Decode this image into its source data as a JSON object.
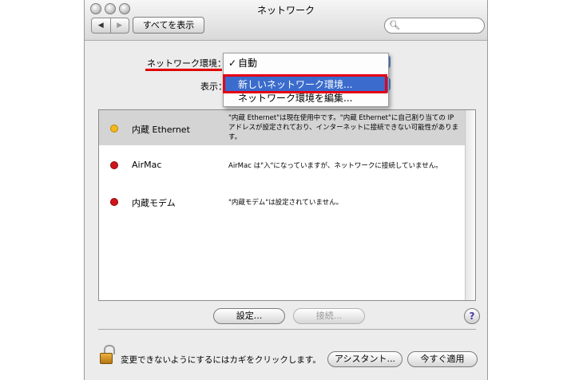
{
  "window": {
    "title": "ネットワーク"
  },
  "toolbar": {
    "back": "◀",
    "forward": "▶",
    "show_all": "すべてを表示",
    "search_placeholder": ""
  },
  "location": {
    "label": "ネットワーク環境："
  },
  "show": {
    "label": "表示："
  },
  "location_menu": {
    "items": [
      {
        "label": "自動",
        "checked": true
      },
      {
        "label": "新しいネットワーク環境...",
        "selected": true
      },
      {
        "label": "ネットワーク環境を編集..."
      }
    ]
  },
  "services": [
    {
      "name": "内蔵 Ethernet",
      "status": "yellow",
      "description": "\"内蔵 Ethernet\"は現在使用中です。\"内蔵 Ethernet\"に自己割り当ての IP アドレスが設定されており、インターネットに接続できない可能性があります。"
    },
    {
      "name": "AirMac",
      "status": "red",
      "description": "AirMac は\"入\"になっていますが、ネットワークに接続していません。"
    },
    {
      "name": "内蔵モデム",
      "status": "red",
      "description": "\"内蔵モデム\"は設定されていません。"
    }
  ],
  "buttons": {
    "configure": "設定...",
    "connect": "接続...",
    "help": "?",
    "assist": "アシスタント...",
    "apply": "今すぐ適用"
  },
  "lock": {
    "text": "変更できないようにするにはカギをクリックします。"
  },
  "colors": {
    "yellow_dot": "#f2b81c",
    "red_dot": "#d0141a",
    "highlight": "#3b6ccd",
    "annotation": "#e60012"
  }
}
